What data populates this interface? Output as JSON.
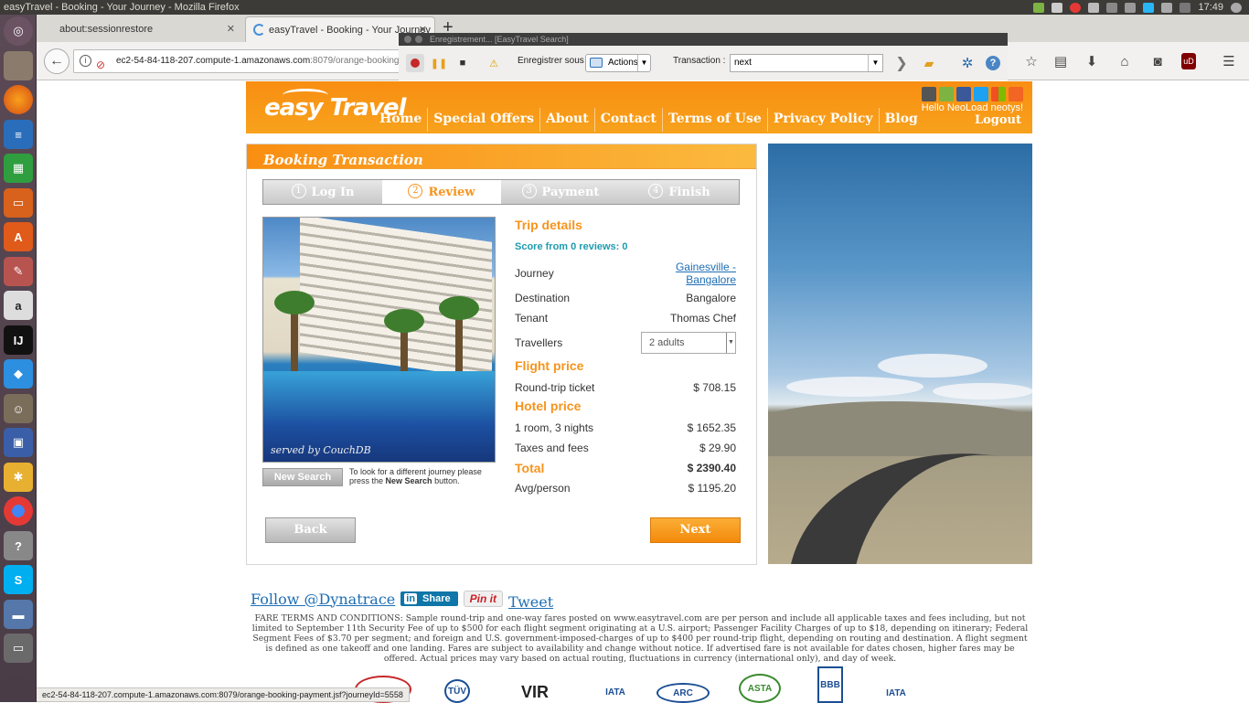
{
  "os": {
    "window_title": "easyTravel - Booking - Your Journey - Mozilla Firefox",
    "clock": "17:49"
  },
  "browser": {
    "tabs": [
      {
        "label": "about:sessionrestore"
      },
      {
        "label": "easyTravel - Booking - Your Journey"
      }
    ],
    "url_host": "ec2-54-84-118-207.compute-1.amazonaws.com",
    "url_rest": ":8079/orange-booking-review",
    "status_url": "ec2-54-84-118-207.compute-1.amazonaws.com:8079/orange-booking-payment.jsf?journeyId=5558"
  },
  "neoload": {
    "title": "Enregistrement... [EasyTravel Search]",
    "save_label": "Enregistrer sous :",
    "save_value": "Actions",
    "transaction_label": "Transaction :",
    "transaction_value": "next"
  },
  "site": {
    "logo": "easy Travel",
    "nav": [
      "Home",
      "Special Offers",
      "About",
      "Contact",
      "Terms of Use",
      "Privacy Policy",
      "Blog"
    ],
    "hello": "Hello NeoLoad neotys!",
    "logout": "Logout"
  },
  "booking": {
    "title": "Booking Transaction",
    "steps": [
      {
        "n": "1",
        "label": "Log In"
      },
      {
        "n": "2",
        "label": "Review"
      },
      {
        "n": "3",
        "label": "Payment"
      },
      {
        "n": "4",
        "label": "Finish"
      }
    ],
    "image_caption": "served by CouchDB",
    "new_search": "New Search",
    "new_search_note_pre": "To look for a different journey please press the ",
    "new_search_note_bold": "New Search",
    "new_search_note_post": " button.",
    "trip_title": "Trip details",
    "score": "Score from 0 reviews: 0",
    "journey_label": "Journey",
    "journey_value": "Gainesville - Bangalore",
    "destination_label": "Destination",
    "destination_value": "Bangalore",
    "tenant_label": "Tenant",
    "tenant_value": "Thomas Chef",
    "travellers_label": "Travellers",
    "travellers_value": "2 adults",
    "flight_title": "Flight price",
    "roundtrip_label": "Round-trip ticket",
    "roundtrip_value": "$ 708.15",
    "hotel_title": "Hotel price",
    "room_label": "1 room, 3 nights",
    "room_value": "$ 1652.35",
    "taxes_label": "Taxes and fees",
    "taxes_value": "$ 29.90",
    "total_label": "Total",
    "total_value": "$ 2390.40",
    "avg_label": "Avg/person",
    "avg_value": "$ 1195.20",
    "back": "Back",
    "next": "Next"
  },
  "social": {
    "follow": "Follow @Dynatrace",
    "share": "Share",
    "pinit": "Pin it",
    "tweet": "Tweet"
  },
  "fare_terms": "FARE TERMS AND CONDITIONS: Sample round-trip and one-way fares posted on www.easytravel.com are per person and include all applicable taxes and fees including, but not limited to September 11th Security Fee of up to $500 for each flight segment originating at a U.S. airport; Passenger Facility Charges of up to $18, depending on itinerary; Federal Segment Fees of $3.70 per segment; and foreign and U.S. government-imposed-charges of up to $400 per round-trip flight, depending on routing and destination. A flight segment is defined as one takeoff and one landing. Fares are subject to availability and change without notice. If advertised fare is not available for dates chosen, higher fares may be offered. Actual prices may vary based on actual routing, fluctuations in currency (international only), and day of week.",
  "badges": [
    "TÜV",
    "VIR",
    "IATA",
    "ARC",
    "ASTA",
    "BBB",
    "IATA"
  ]
}
